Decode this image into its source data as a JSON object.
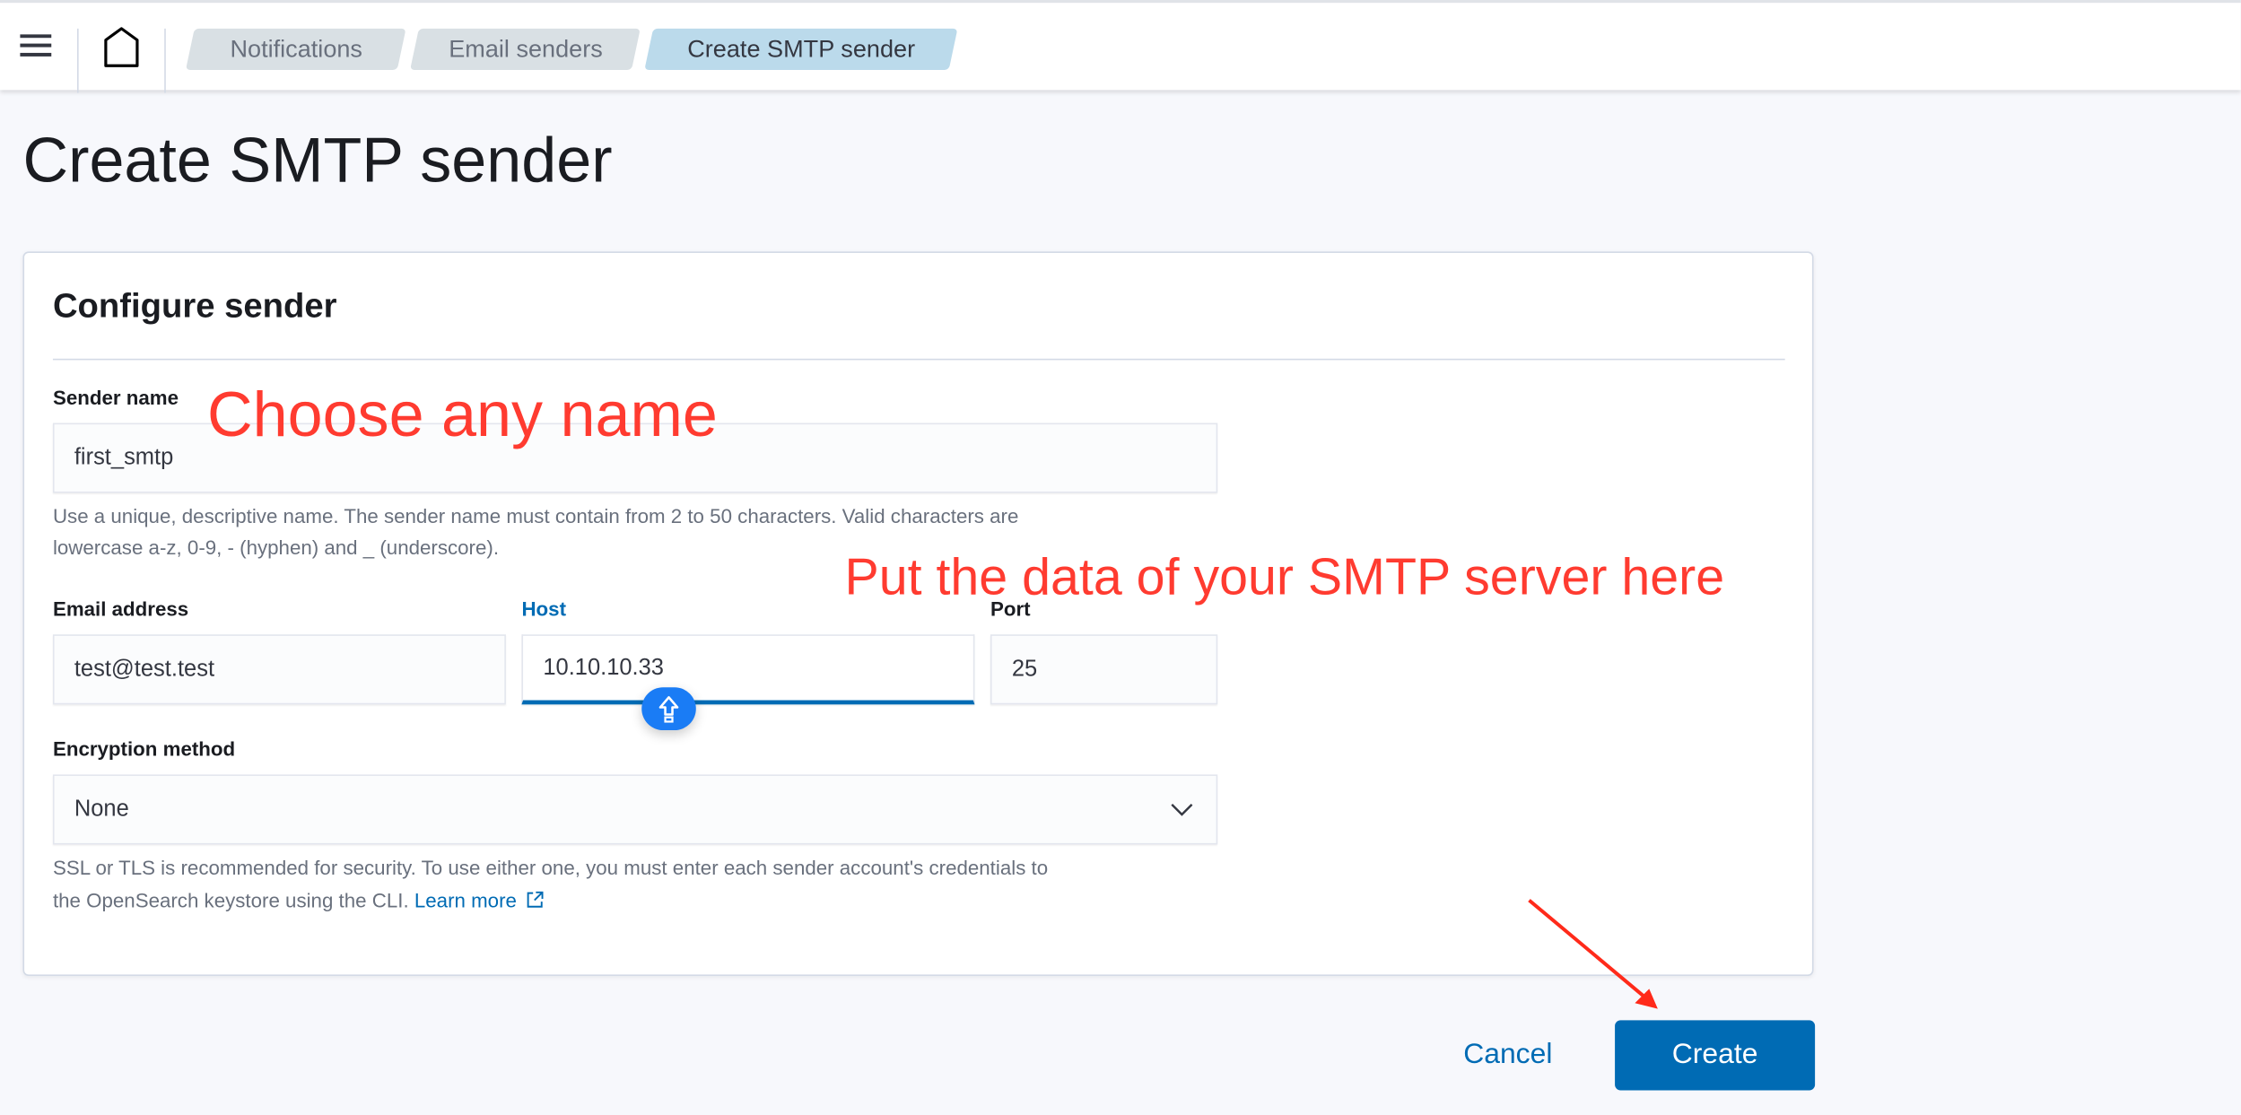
{
  "header": {
    "breadcrumbs": [
      {
        "label": "Notifications"
      },
      {
        "label": "Email senders"
      },
      {
        "label": "Create SMTP sender"
      }
    ]
  },
  "page": {
    "title": "Create SMTP sender"
  },
  "panel": {
    "title": "Configure sender",
    "sender_name": {
      "label": "Sender name",
      "value": "first_smtp",
      "help": "Use a unique, descriptive name. The sender name must contain from 2 to 50 characters. Valid characters are",
      "help2": "lowercase a-z, 0-9, - (hyphen) and _ (underscore)."
    },
    "email": {
      "label": "Email address",
      "value": "test@test.test"
    },
    "host": {
      "label": "Host",
      "value": "10.10.10.33"
    },
    "port": {
      "label": "Port",
      "value": "25"
    },
    "encryption": {
      "label": "Encryption method",
      "value": "None",
      "help": "SSL or TLS is recommended for security. To use either one, you must enter each sender account's credentials to",
      "help2": "the OpenSearch keystore using the CLI.",
      "link": "Learn more"
    }
  },
  "actions": {
    "cancel": "Cancel",
    "create": "Create"
  },
  "annotations": {
    "name_hint": "Choose any name",
    "server_hint": "Put the data of your SMTP server here"
  },
  "colors": {
    "accent": "#006bb4",
    "annotation": "#ff3b30"
  }
}
